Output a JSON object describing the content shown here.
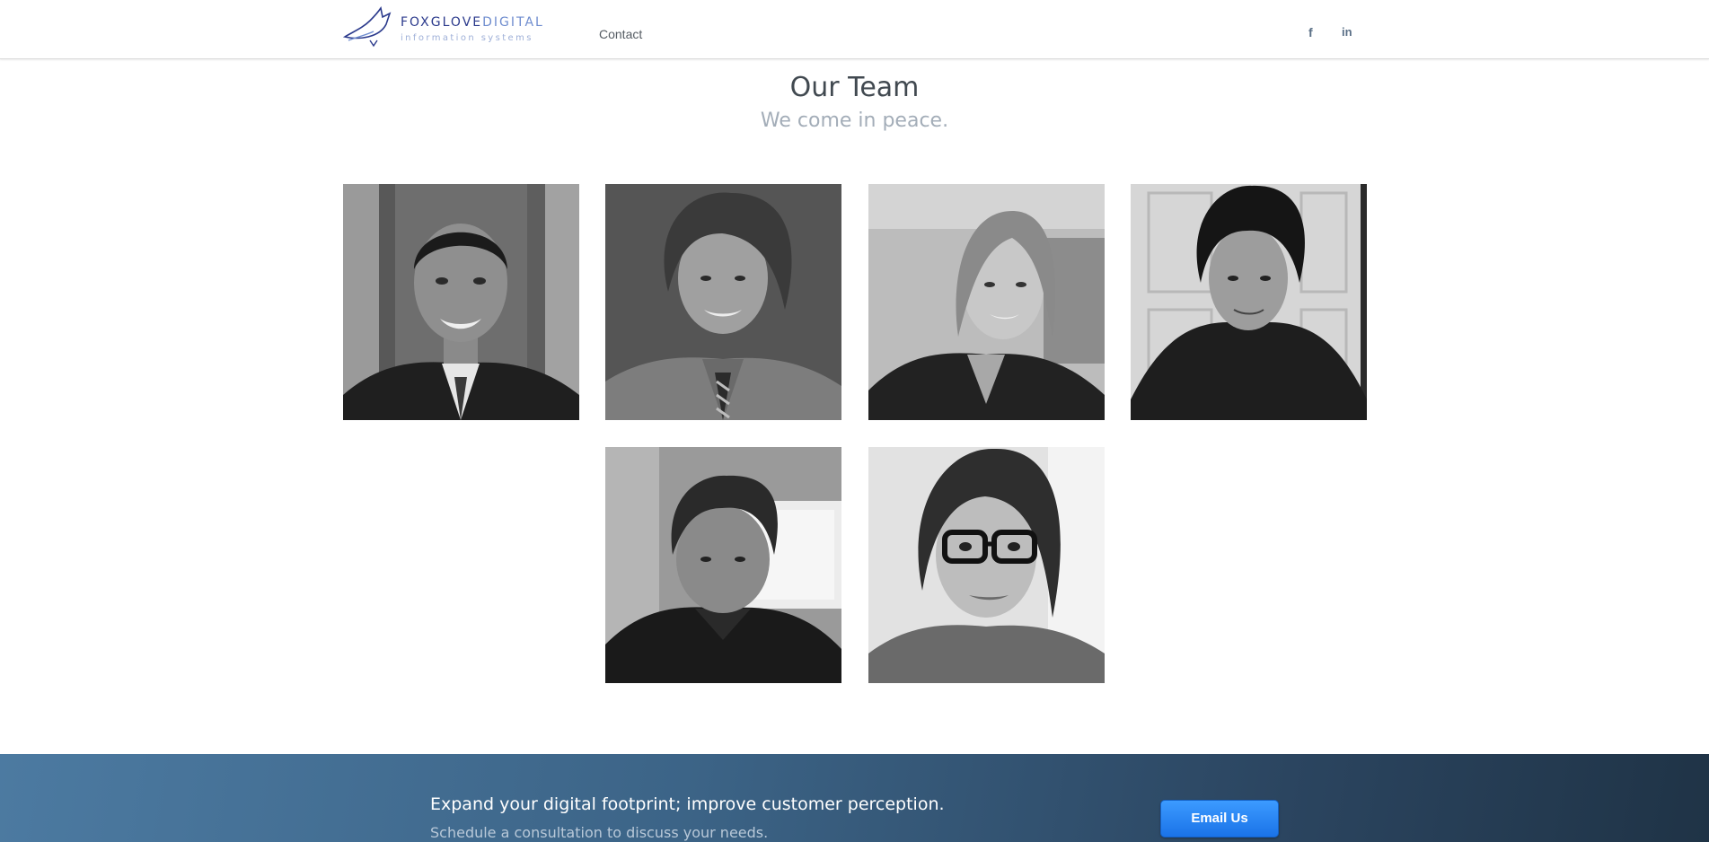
{
  "header": {
    "logo": {
      "brand_part1": "FOXGLOVE",
      "brand_part2": "DIGITAL",
      "tagline": "information systems"
    },
    "nav": {
      "contact_label": "Contact"
    },
    "social": {
      "facebook_glyph": "f",
      "linkedin_glyph": "in",
      "facebook_icon": "facebook-icon",
      "linkedin_icon": "linkedin-icon"
    }
  },
  "team": {
    "title": "Our Team",
    "subtitle": "We come in peace.",
    "members": [
      {
        "photo": "team-member-photo-1"
      },
      {
        "photo": "team-member-photo-2"
      },
      {
        "photo": "team-member-photo-3"
      },
      {
        "photo": "team-member-photo-4"
      },
      {
        "photo": "team-member-photo-5"
      },
      {
        "photo": "team-member-photo-6"
      }
    ]
  },
  "cta": {
    "title": "Expand your digital footprint; improve customer perception.",
    "subtitle": "Schedule a consultation to discuss your needs.",
    "button_label": "Email Us",
    "button_color": "#1a73e8",
    "band_color": "#3c6487"
  }
}
